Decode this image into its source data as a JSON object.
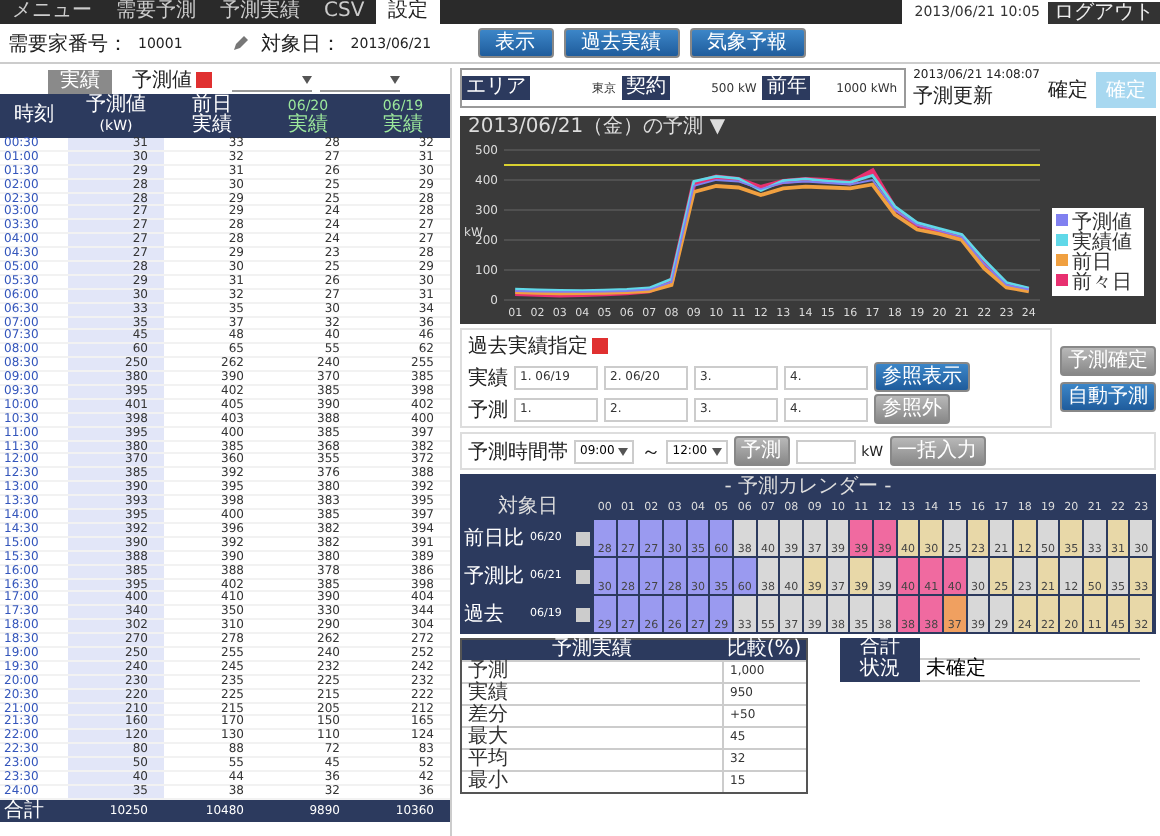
{
  "nav": {
    "tabs": [
      {
        "label": "メニュー",
        "selected": false
      },
      {
        "label": "需要予測",
        "selected": false
      },
      {
        "label": "予測実績",
        "selected": false
      },
      {
        "label": "CSV",
        "selected": false
      },
      {
        "label": "設定",
        "selected": true
      }
    ],
    "clock": "2013/06/21 10:05",
    "logout": "ログアウト"
  },
  "toolbar": {
    "customer_label": "需要家番号：",
    "customer": "10001",
    "date_label": "対象日：",
    "date": "2013/06/21",
    "buttons": [
      {
        "label": "表示",
        "kind": "primary"
      },
      {
        "label": "過去実績",
        "kind": "primary"
      },
      {
        "label": "気象予報",
        "kind": "primary"
      }
    ]
  },
  "left": {
    "tabs": [
      {
        "label": "実績",
        "selected": true
      },
      {
        "label": "予測値",
        "selected": false
      }
    ],
    "columns": [
      {
        "label": "時刻"
      },
      {
        "label": "予測値",
        "sub": "(kW)"
      },
      {
        "label": "前日",
        "sub": "実績"
      },
      {
        "label": "06/20",
        "sub": "実績"
      },
      {
        "label": "06/19",
        "sub": "実績"
      }
    ],
    "rows": [
      {
        "cells": [
          "00:30",
          "31",
          "33",
          "28",
          "32"
        ]
      },
      {
        "cells": [
          "01:00",
          "30",
          "32",
          "27",
          "31"
        ]
      },
      {
        "cells": [
          "01:30",
          "29",
          "31",
          "26",
          "30"
        ]
      },
      {
        "cells": [
          "02:00",
          "28",
          "30",
          "25",
          "29"
        ]
      },
      {
        "cells": [
          "02:30",
          "28",
          "29",
          "25",
          "28"
        ]
      },
      {
        "cells": [
          "03:00",
          "27",
          "29",
          "24",
          "28"
        ]
      },
      {
        "cells": [
          "03:30",
          "27",
          "28",
          "24",
          "27"
        ]
      },
      {
        "cells": [
          "04:00",
          "27",
          "28",
          "24",
          "27"
        ]
      },
      {
        "cells": [
          "04:30",
          "27",
          "29",
          "23",
          "28"
        ]
      },
      {
        "cells": [
          "05:00",
          "28",
          "30",
          "25",
          "29"
        ]
      },
      {
        "cells": [
          "05:30",
          "29",
          "31",
          "26",
          "30"
        ]
      },
      {
        "cells": [
          "06:00",
          "30",
          "32",
          "27",
          "31"
        ]
      },
      {
        "cells": [
          "06:30",
          "33",
          "35",
          "30",
          "34"
        ]
      },
      {
        "cells": [
          "07:00",
          "35",
          "37",
          "32",
          "36"
        ]
      },
      {
        "cells": [
          "07:30",
          "45",
          "48",
          "40",
          "46"
        ]
      },
      {
        "cells": [
          "08:00",
          "60",
          "65",
          "55",
          "62"
        ]
      },
      {
        "cells": [
          "08:30",
          "250",
          "262",
          "240",
          "255"
        ]
      },
      {
        "cells": [
          "09:00",
          "380",
          "390",
          "370",
          "385"
        ]
      },
      {
        "cells": [
          "09:30",
          "395",
          "402",
          "385",
          "398"
        ]
      },
      {
        "cells": [
          "10:00",
          "401",
          "405",
          "390",
          "402"
        ]
      },
      {
        "cells": [
          "10:30",
          "398",
          "403",
          "388",
          "400"
        ]
      },
      {
        "cells": [
          "11:00",
          "395",
          "400",
          "385",
          "397"
        ]
      },
      {
        "cells": [
          "11:30",
          "380",
          "385",
          "368",
          "382"
        ]
      },
      {
        "cells": [
          "12:00",
          "370",
          "360",
          "355",
          "372"
        ]
      },
      {
        "cells": [
          "12:30",
          "385",
          "392",
          "376",
          "388"
        ]
      },
      {
        "cells": [
          "13:00",
          "390",
          "395",
          "380",
          "392"
        ]
      },
      {
        "cells": [
          "13:30",
          "393",
          "398",
          "383",
          "395"
        ]
      },
      {
        "cells": [
          "14:00",
          "395",
          "400",
          "385",
          "397"
        ]
      },
      {
        "cells": [
          "14:30",
          "392",
          "396",
          "382",
          "394"
        ]
      },
      {
        "cells": [
          "15:00",
          "390",
          "392",
          "382",
          "391"
        ]
      },
      {
        "cells": [
          "15:30",
          "388",
          "390",
          "380",
          "389"
        ]
      },
      {
        "cells": [
          "16:00",
          "385",
          "388",
          "378",
          "386"
        ]
      },
      {
        "cells": [
          "16:30",
          "395",
          "402",
          "385",
          "398"
        ]
      },
      {
        "cells": [
          "17:00",
          "400",
          "410",
          "390",
          "404"
        ]
      },
      {
        "cells": [
          "17:30",
          "340",
          "350",
          "330",
          "344"
        ]
      },
      {
        "cells": [
          "18:00",
          "302",
          "310",
          "290",
          "304"
        ]
      },
      {
        "cells": [
          "18:30",
          "270",
          "278",
          "262",
          "272"
        ]
      },
      {
        "cells": [
          "19:00",
          "250",
          "255",
          "240",
          "252"
        ]
      },
      {
        "cells": [
          "19:30",
          "240",
          "245",
          "232",
          "242"
        ]
      },
      {
        "cells": [
          "20:00",
          "230",
          "235",
          "225",
          "232"
        ]
      },
      {
        "cells": [
          "20:30",
          "220",
          "225",
          "215",
          "222"
        ]
      },
      {
        "cells": [
          "21:00",
          "210",
          "215",
          "205",
          "212"
        ]
      },
      {
        "cells": [
          "21:30",
          "160",
          "170",
          "150",
          "165"
        ]
      },
      {
        "cells": [
          "22:00",
          "120",
          "130",
          "110",
          "124"
        ]
      },
      {
        "cells": [
          "22:30",
          "80",
          "88",
          "72",
          "83"
        ]
      },
      {
        "cells": [
          "23:00",
          "50",
          "55",
          "45",
          "52"
        ]
      },
      {
        "cells": [
          "23:30",
          "40",
          "44",
          "36",
          "42"
        ]
      },
      {
        "cells": [
          "24:00",
          "35",
          "38",
          "32",
          "36"
        ]
      }
    ],
    "total": {
      "cells": [
        "合計",
        "10250",
        "10480",
        "9890",
        "10360"
      ]
    }
  },
  "info": {
    "fields": [
      {
        "label": "エリア",
        "value": "東京"
      },
      {
        "label": "契約",
        "value": "500 kW"
      },
      {
        "label": "前年",
        "value": "1000 kWh"
      }
    ],
    "updated": "2013/06/21 14:08:07",
    "update_label": "予測更新",
    "confirm_label": "確定",
    "confirm_button": "確定"
  },
  "chart": {
    "title": "2013/06/21（金）の予測 ▼",
    "chart_data": {
      "type": "line",
      "ylabel": "kW",
      "categories": [
        "01",
        "02",
        "03",
        "04",
        "05",
        "06",
        "07",
        "08",
        "09",
        "10",
        "11",
        "12",
        "13",
        "14",
        "15",
        "16",
        "17",
        "18",
        "19",
        "20",
        "21",
        "22",
        "23",
        "24"
      ],
      "ylim": [
        0,
        500
      ],
      "yticks": [
        0,
        100,
        200,
        300,
        400,
        500
      ],
      "grid": true,
      "legend": true,
      "ref_lines": [
        {
          "axis": "y",
          "value": 450,
          "color": "#d8d030"
        }
      ],
      "series": [
        {
          "name": "予測値",
          "color": "#8080f0",
          "values": [
            30,
            28,
            27,
            27,
            28,
            30,
            35,
            60,
            380,
            400,
            395,
            370,
            390,
            395,
            390,
            385,
            400,
            300,
            250,
            230,
            210,
            120,
            50,
            35
          ]
        },
        {
          "name": "実績値",
          "color": "#60d8e8",
          "values": [
            36,
            34,
            32,
            31,
            33,
            35,
            40,
            70,
            395,
            412,
            405,
            365,
            398,
            404,
            396,
            392,
            415,
            312,
            258,
            238,
            218,
            134,
            58,
            40
          ]
        },
        {
          "name": "前日",
          "color": "#f0a040",
          "values": [
            26,
            24,
            22,
            23,
            24,
            26,
            30,
            50,
            360,
            380,
            375,
            350,
            372,
            378,
            375,
            372,
            385,
            285,
            235,
            220,
            200,
            105,
            42,
            29
          ]
        },
        {
          "name": "前々日",
          "color": "#e83070",
          "values": [
            22,
            19,
            17,
            18,
            21,
            24,
            31,
            62,
            388,
            410,
            402,
            375,
            395,
            402,
            398,
            390,
            430,
            305,
            252,
            230,
            212,
            126,
            52,
            34
          ]
        }
      ]
    }
  },
  "past": {
    "title": "過去実績指定",
    "rows": [
      {
        "label": "実績",
        "fields": [
          "1. 06/19",
          "2. 06/20",
          "3.",
          "4."
        ]
      },
      {
        "label": "予測",
        "fields": [
          "1.",
          "2.",
          "3.",
          "4."
        ]
      }
    ],
    "buttons": [
      {
        "label": "参照表示",
        "kind": "primary"
      },
      {
        "label": "参照外",
        "kind": "secondary"
      }
    ],
    "side_buttons": [
      {
        "label": "予測確定",
        "kind": "secondary"
      },
      {
        "label": "自動予測",
        "kind": "primary"
      }
    ]
  },
  "range": {
    "title": "予測時間帯",
    "from": "09:00",
    "to": "12:00",
    "separator": "～",
    "apply": "予測",
    "unit": "kW",
    "bulk": "一括入力"
  },
  "heat": {
    "title": "- 予測カレンダー -",
    "head": "対象日",
    "hours": [
      "00",
      "01",
      "02",
      "03",
      "04",
      "05",
      "06",
      "07",
      "08",
      "09",
      "10",
      "11",
      "12",
      "13",
      "14",
      "15",
      "16",
      "17",
      "18",
      "19",
      "20",
      "21",
      "22",
      "23"
    ],
    "rows": [
      {
        "label": "前日比",
        "date": "06/20",
        "cells": [
          {
            "value": "28",
            "color": "#9a9af0"
          },
          {
            "value": "27",
            "color": "#9a9af0"
          },
          {
            "value": "27",
            "color": "#9a9af0"
          },
          {
            "value": "30",
            "color": "#9a9af0"
          },
          {
            "value": "35",
            "color": "#9a9af0"
          },
          {
            "value": "60",
            "color": "#9a9af0"
          },
          {
            "value": "38",
            "color": "#d8d8d8"
          },
          {
            "value": "40",
            "color": "#d8d8d8"
          },
          {
            "value": "39",
            "color": "#d8d8d8"
          },
          {
            "value": "37",
            "color": "#d8d8d8"
          },
          {
            "value": "39",
            "color": "#d8d8d8"
          },
          {
            "value": "39",
            "color": "#f06aa0"
          },
          {
            "value": "39",
            "color": "#f06aa0"
          },
          {
            "value": "40",
            "color": "#e8d8a8"
          },
          {
            "value": "30",
            "color": "#e8d8a8"
          },
          {
            "value": "25",
            "color": "#d8d8d8"
          },
          {
            "value": "23",
            "color": "#e8d8a8"
          },
          {
            "value": "21",
            "color": "#d8d8d8"
          },
          {
            "value": "12",
            "color": "#e8d8a8"
          },
          {
            "value": "50",
            "color": "#d8d8d8"
          },
          {
            "value": "35",
            "color": "#e8d8a8"
          },
          {
            "value": "33",
            "color": "#d8d8d8"
          },
          {
            "value": "31",
            "color": "#e8d8a8"
          },
          {
            "value": "30",
            "color": "#d8d8d8"
          }
        ]
      },
      {
        "label": "予測比",
        "date": "06/21",
        "cells": [
          {
            "value": "30",
            "color": "#9a9af0"
          },
          {
            "value": "28",
            "color": "#9a9af0"
          },
          {
            "value": "27",
            "color": "#9a9af0"
          },
          {
            "value": "28",
            "color": "#9a9af0"
          },
          {
            "value": "30",
            "color": "#9a9af0"
          },
          {
            "value": "35",
            "color": "#9a9af0"
          },
          {
            "value": "60",
            "color": "#9a9af0"
          },
          {
            "value": "38",
            "color": "#d8d8d8"
          },
          {
            "value": "40",
            "color": "#d8d8d8"
          },
          {
            "value": "39",
            "color": "#e8d8a8"
          },
          {
            "value": "37",
            "color": "#d8d8d8"
          },
          {
            "value": "39",
            "color": "#e8d8a8"
          },
          {
            "value": "39",
            "color": "#d8d8d8"
          },
          {
            "value": "40",
            "color": "#f06aa0"
          },
          {
            "value": "41",
            "color": "#f06aa0"
          },
          {
            "value": "40",
            "color": "#f06aa0"
          },
          {
            "value": "30",
            "color": "#d8d8d8"
          },
          {
            "value": "25",
            "color": "#e8d8a8"
          },
          {
            "value": "23",
            "color": "#d8d8d8"
          },
          {
            "value": "21",
            "color": "#e8d8a8"
          },
          {
            "value": "12",
            "color": "#d8d8d8"
          },
          {
            "value": "50",
            "color": "#e8d8a8"
          },
          {
            "value": "35",
            "color": "#d8d8d8"
          },
          {
            "value": "33",
            "color": "#e8d8a8"
          }
        ]
      },
      {
        "label": "過去",
        "date": "06/19",
        "cells": [
          {
            "value": "29",
            "color": "#9a9af0"
          },
          {
            "value": "27",
            "color": "#9a9af0"
          },
          {
            "value": "26",
            "color": "#9a9af0"
          },
          {
            "value": "26",
            "color": "#9a9af0"
          },
          {
            "value": "27",
            "color": "#9a9af0"
          },
          {
            "value": "29",
            "color": "#9a9af0"
          },
          {
            "value": "33",
            "color": "#d8d8d8"
          },
          {
            "value": "55",
            "color": "#d8d8d8"
          },
          {
            "value": "37",
            "color": "#d8d8d8"
          },
          {
            "value": "39",
            "color": "#d8d8d8"
          },
          {
            "value": "38",
            "color": "#d8d8d8"
          },
          {
            "value": "35",
            "color": "#d8d8d8"
          },
          {
            "value": "38",
            "color": "#d8d8d8"
          },
          {
            "value": "38",
            "color": "#f06aa0"
          },
          {
            "value": "38",
            "color": "#f06aa0"
          },
          {
            "value": "37",
            "color": "#f0a060"
          },
          {
            "value": "39",
            "color": "#d8d8d8"
          },
          {
            "value": "29",
            "color": "#d8d8d8"
          },
          {
            "value": "24",
            "color": "#e8d8a8"
          },
          {
            "value": "22",
            "color": "#e8d8a8"
          },
          {
            "value": "20",
            "color": "#e8d8a8"
          },
          {
            "value": "11",
            "color": "#e8d8a8"
          },
          {
            "value": "45",
            "color": "#e8d8a8"
          },
          {
            "value": "32",
            "color": "#e8d8a8"
          }
        ]
      }
    ]
  },
  "summary": {
    "columns": [
      "予測実績",
      "比較(%)"
    ],
    "rows": [
      {
        "label": "予測",
        "value": "1,000"
      },
      {
        "label": "実績",
        "value": "950"
      },
      {
        "label": "差分",
        "value": "+50"
      },
      {
        "label": "最大",
        "value": "45"
      },
      {
        "label": "平均",
        "value": "32"
      },
      {
        "label": "最小",
        "value": "15"
      }
    ]
  },
  "status": {
    "rows": [
      {
        "label": "合計",
        "value": ""
      },
      {
        "label": "状況",
        "value": "未確定"
      }
    ]
  }
}
